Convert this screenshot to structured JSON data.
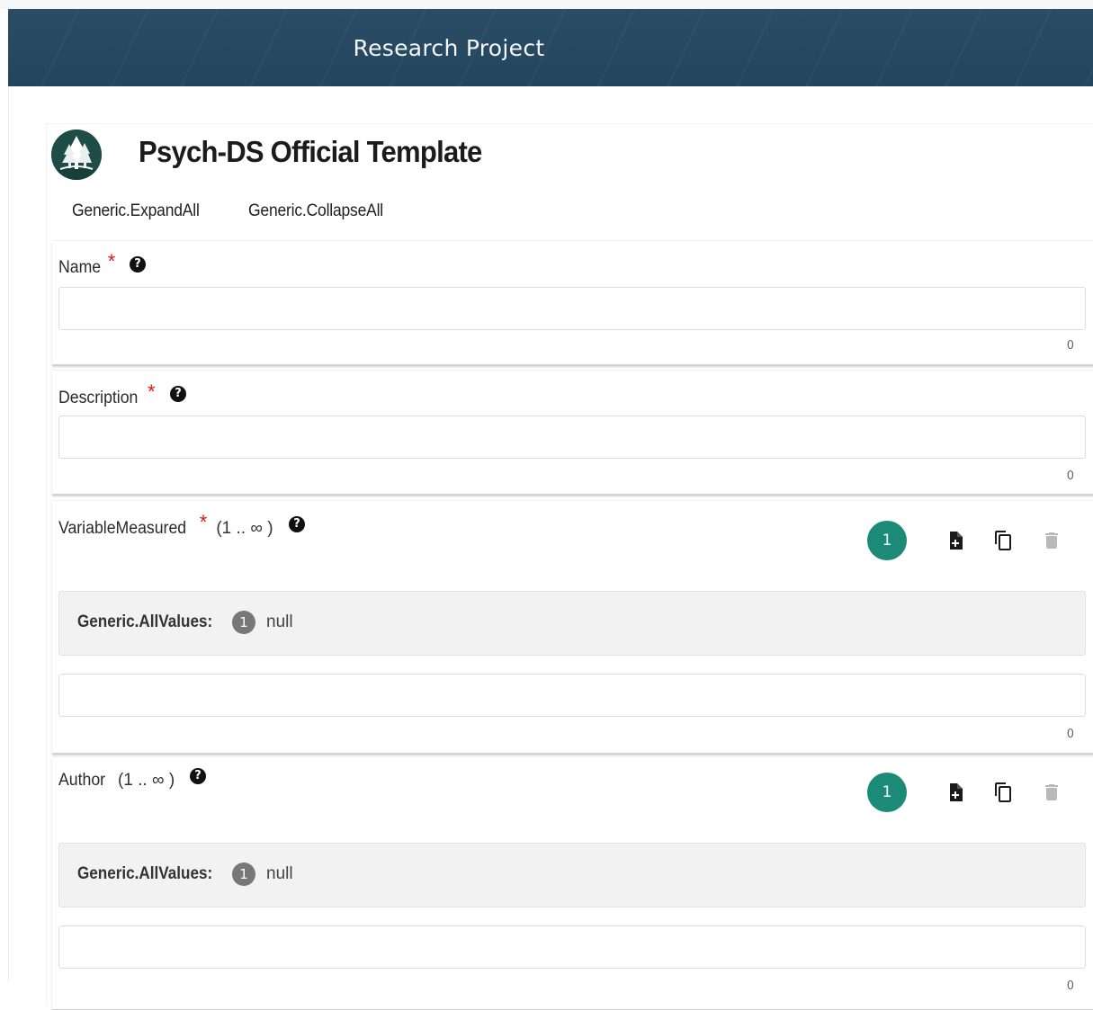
{
  "header": {
    "title": "Research Project"
  },
  "template": {
    "title": "Psych-DS Official Template"
  },
  "toolbar": {
    "expand_all": "Generic.ExpandAll",
    "collapse_all": "Generic.CollapseAll"
  },
  "fields": {
    "name": {
      "label": "Name",
      "required_mark": "*",
      "help": "?",
      "value": "",
      "counter": "0"
    },
    "description": {
      "label": "Description",
      "required_mark": "*",
      "help": "?",
      "value": "",
      "counter": "0"
    },
    "variable_measured": {
      "label": "VariableMeasured",
      "required_mark": "*",
      "cardinality": "(1 .. ∞ )",
      "help": "?",
      "count": "1",
      "all_values_label": "Generic.AllValues:",
      "values_count": "1",
      "values_text": "null",
      "value": "",
      "counter": "0"
    },
    "author": {
      "label": "Author",
      "cardinality": "(1 .. ∞ )",
      "help": "?",
      "count": "1",
      "all_values_label": "Generic.AllValues:",
      "values_count": "1",
      "values_text": "null",
      "value": "",
      "counter": "0"
    }
  },
  "icons": {
    "logo": "tree-logo-icon",
    "add": "add-document-icon",
    "copy": "copy-icon",
    "delete": "trash-icon",
    "help": "question-circle-icon"
  },
  "colors": {
    "header_bg": "#23455d",
    "logo_bg": "#1e4d48",
    "badge_teal": "#1b8a77",
    "required_red": "#e0161a",
    "values_bg": "#f2f2f2"
  }
}
